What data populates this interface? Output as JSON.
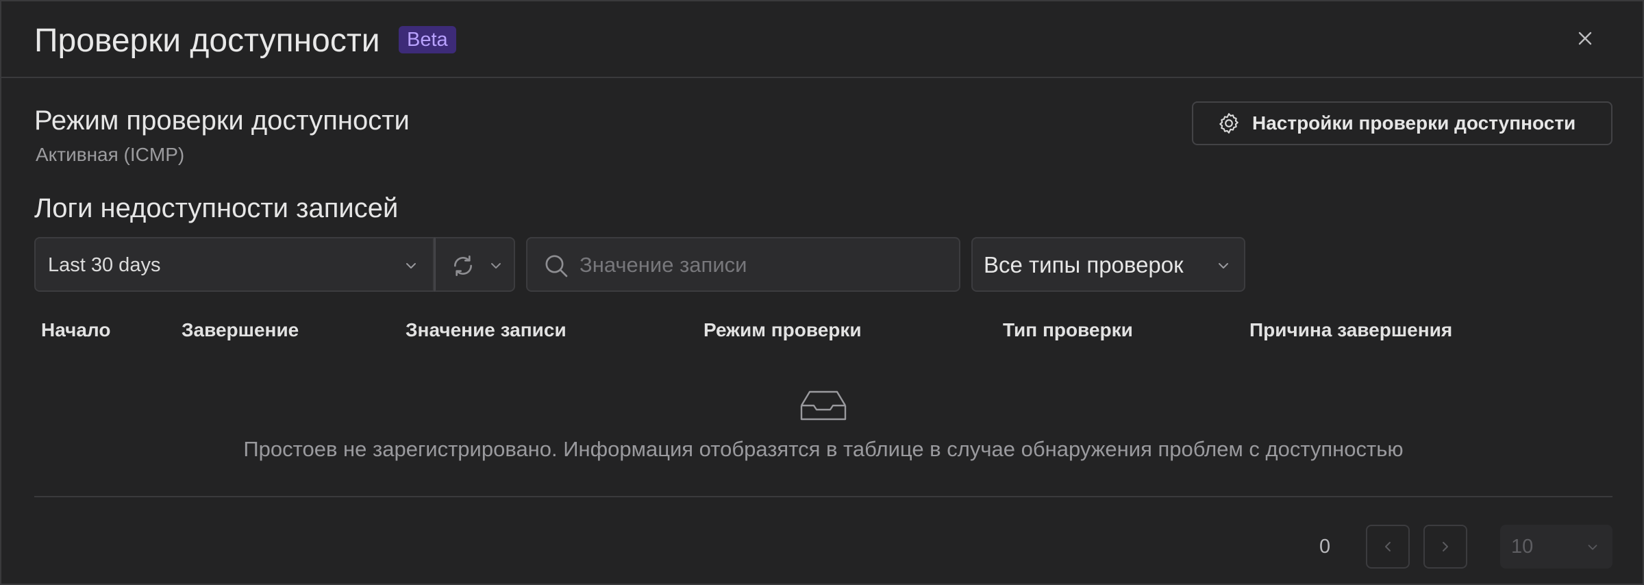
{
  "dialog": {
    "title": "Проверки доступности",
    "badge": "Beta",
    "close_icon": "close-icon"
  },
  "mode": {
    "title": "Режим проверки доступности",
    "value": "Активная (ICMP)"
  },
  "settings_button": {
    "label": "Настройки проверки доступности",
    "icon": "gear-icon"
  },
  "logs": {
    "title": "Логи недоступности записей",
    "filters": {
      "range": "Last 30 days",
      "search_placeholder": "Значение записи",
      "search_value": "",
      "check_type": "Все типы проверок"
    },
    "columns": [
      "Начало",
      "Завершение",
      "Значение записи",
      "Режим проверки",
      "Тип проверки",
      "Причина завершения"
    ],
    "rows": [],
    "empty_message": "Простоев не зарегистрировано. Информация отобразятся в таблице в случае обнаружения проблем с доступностью",
    "empty_icon": "empty-inbox-icon"
  },
  "pagination": {
    "total": "0",
    "page_size": "10"
  },
  "colors": {
    "background": "#232324",
    "badge_bg": "#3d2b78",
    "badge_text": "#b9a2ff"
  }
}
